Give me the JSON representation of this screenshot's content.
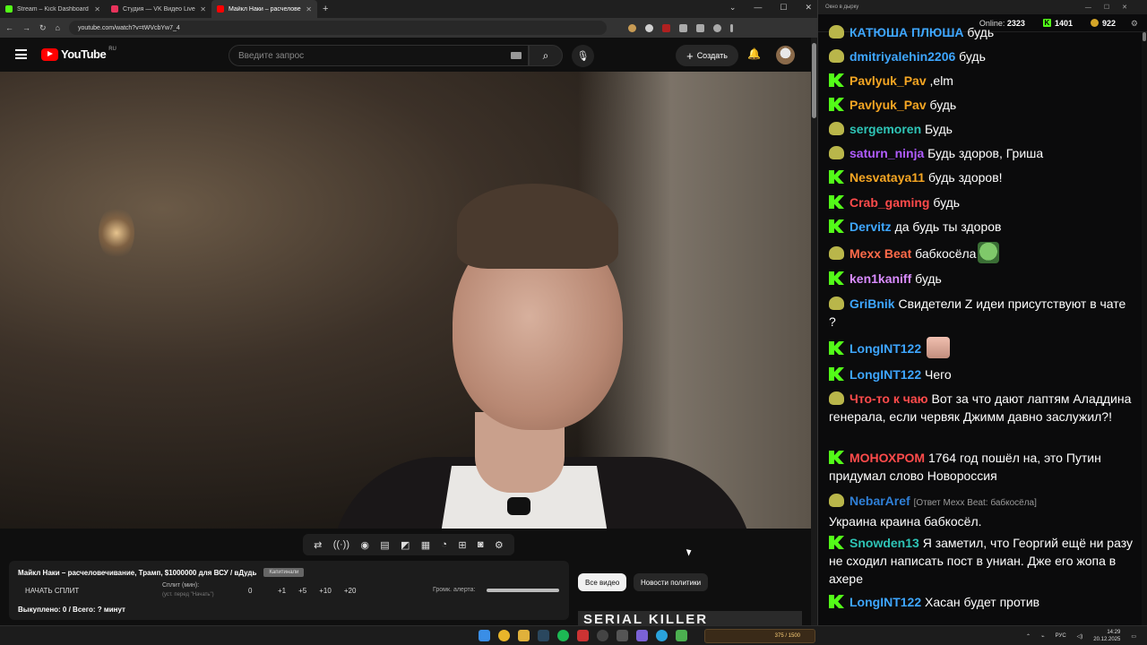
{
  "browser": {
    "tabs": [
      {
        "label": "Stream – Kick Dashboard",
        "color": "#53fc18"
      },
      {
        "label": "Студия — VK Видео Live",
        "color": "#e8335b"
      },
      {
        "label": "Майкл Наки – расчелове",
        "color": "#ff0000"
      }
    ],
    "url": "youtube.com/watch?v=tWVcbYw7_4"
  },
  "youtube": {
    "logo": "YouTube",
    "region": "RU",
    "search_placeholder": "Введите запрос",
    "create_label": "Создать"
  },
  "toolbar_icons": [
    "repeat-icon",
    "broadcast-icon",
    "view-icon",
    "clapper-icon",
    "picture-icon",
    "film-icon",
    "speed-icon",
    "add-icon",
    "camera-icon",
    "settings-icon"
  ],
  "panel": {
    "title": "Майкл Наки – расчеловечивание, Трамп, $1000000 для ВСУ / вДудь",
    "title_tag": "Капитинали",
    "start_split": "НАЧАТЬ СПЛИТ",
    "split_label": "Сплит (мин):",
    "split_sub": "(уст. перед \"Начать\")",
    "split_value": "0",
    "increments": [
      "+1",
      "+5",
      "+10",
      "+20"
    ],
    "alert_label": "Громк. алерта:",
    "bought": "Выкуплено: 0 / Всего: ? минут"
  },
  "chips": {
    "all": "Все видео",
    "politics": "Новости политики"
  },
  "thumbnail_text": "SERIAL KILLER",
  "chat": {
    "window_title": "Окно в дырку",
    "online_label": "Online:",
    "online_count": "2323",
    "kick_count": "1401",
    "coin_count": "922",
    "messages": [
      {
        "badge": "p",
        "nick": "КАТЮША ПЛЮША",
        "color": "#3ea6ff",
        "text": "будь"
      },
      {
        "badge": "p",
        "nick": "dmitriyalehin2206",
        "color": "#3ea6ff",
        "text": "будь"
      },
      {
        "badge": "k",
        "nick": "Pavlyuk_Pav",
        "color": "#f5a623",
        "text": ",elm"
      },
      {
        "badge": "k",
        "nick": "Pavlyuk_Pav",
        "color": "#f5a623",
        "text": "будь"
      },
      {
        "badge": "p",
        "nick": "sergemoren",
        "color": "#2ec4b6",
        "text": "Будь"
      },
      {
        "badge": "p",
        "nick": "saturn_ninja",
        "color": "#b05cff",
        "text": "Будь здоров, Гриша"
      },
      {
        "badge": "k",
        "nick": "Nesvataya11",
        "color": "#f5a623",
        "text": "будь здоров!"
      },
      {
        "badge": "k",
        "nick": "Crab_gaming",
        "color": "#ff4b4b",
        "text": "будь"
      },
      {
        "badge": "k",
        "nick": "Dervitz",
        "color": "#3ea6ff",
        "text": "да будь ты здоров"
      },
      {
        "badge": "p",
        "nick": "Mexx Beat",
        "color": "#ff6b4a",
        "text": "бабкосёла",
        "emote": "frog"
      },
      {
        "badge": "k",
        "nick": "ken1kaniff",
        "color": "#d98cff",
        "text": "будь"
      },
      {
        "badge": "p",
        "nick": "GriBnik",
        "color": "#3ea6ff",
        "text": "Свидетели Z идеи присутствуют в чате ?"
      },
      {
        "badge": "k",
        "nick": "LongINT122",
        "color": "#3ea6ff",
        "text": "",
        "emote": "face"
      },
      {
        "badge": "k",
        "nick": "LongINT122",
        "color": "#3ea6ff",
        "text": "Чего"
      },
      {
        "badge": "p",
        "nick": "Что-то к чаю",
        "color": "#ff4b4b",
        "text": "Вот за что дают лаптям Аладдина генерала, если червяк Джимм давно заслужил?!"
      },
      {
        "badge": "k",
        "nick": "МОНОХРОМ",
        "color": "#ff4b4b",
        "text": "1764 год пошёл на, это Путин придумал слово Новороссия"
      },
      {
        "badge": "p",
        "nick": "NebarAref",
        "color": "#2f7fd6",
        "reply": "[Ответ Mexx Beat: бабкосёла]",
        "text": "Украина краина бабкосёл."
      },
      {
        "badge": "k",
        "nick": "Snowden13",
        "color": "#2ec4b6",
        "text": "Я заметил, что Георгий ещё ни разу не сходил написать пост в униан. Дже его жопа в ахере"
      },
      {
        "badge": "k",
        "nick": "LongINT122",
        "color": "#3ea6ff",
        "text": "Хасан будет против"
      }
    ]
  },
  "taskbar": {
    "widget_text": "375 / 1500",
    "lang": "РУС",
    "time": "14:29",
    "date": "20.12.2025"
  }
}
